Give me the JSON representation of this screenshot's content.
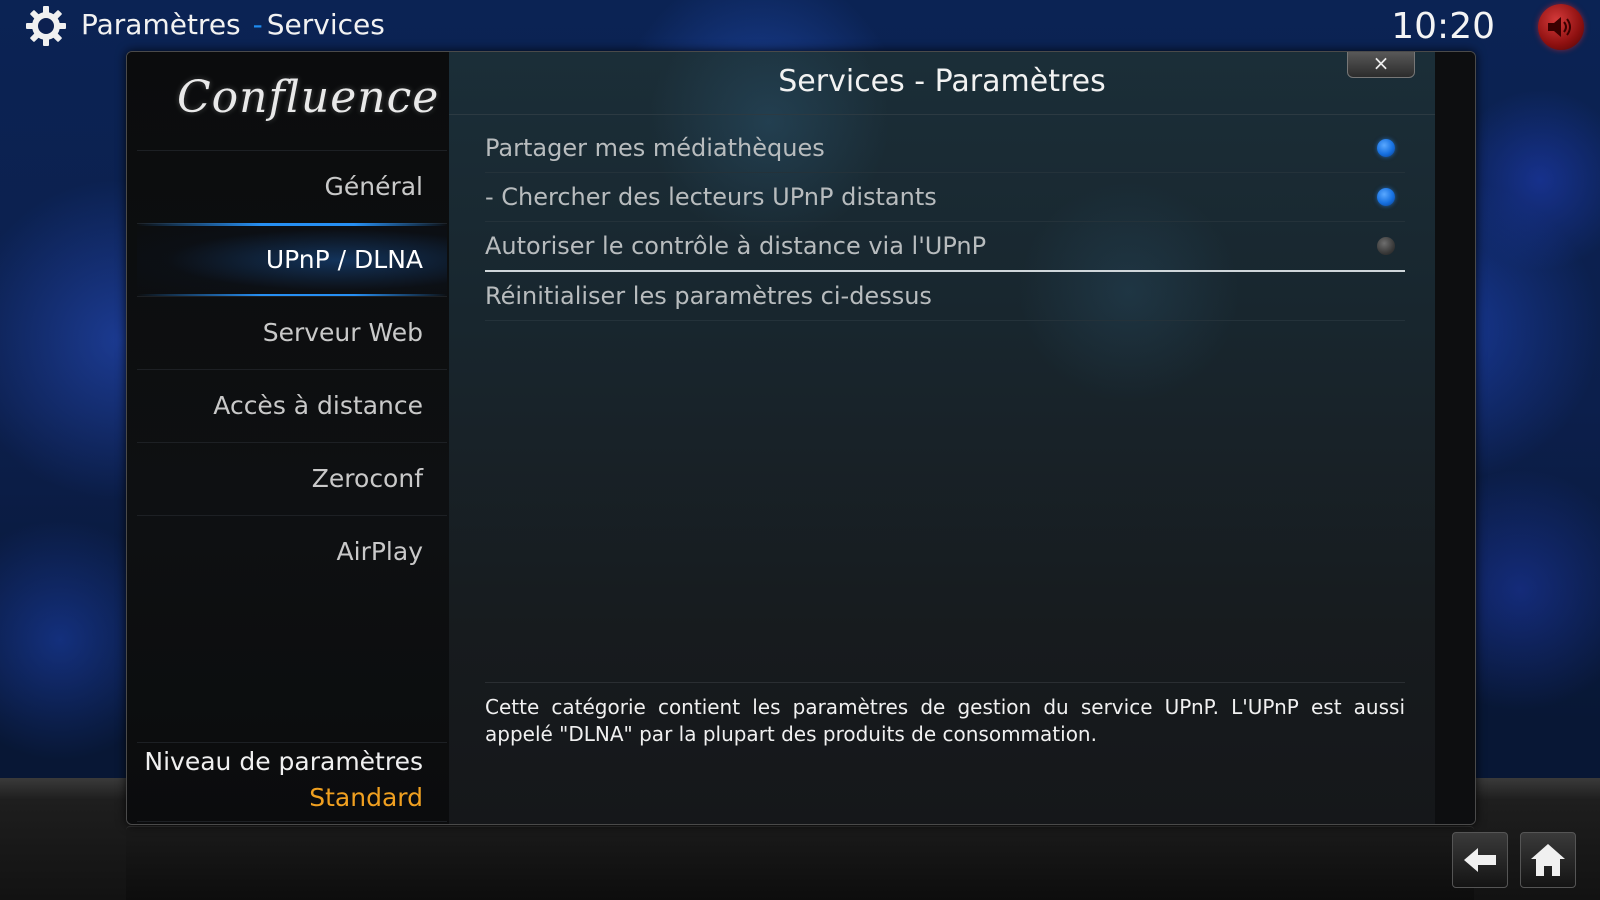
{
  "header": {
    "section": "Paramètres",
    "separator": "-",
    "page": "Services",
    "clock": "10:20",
    "settings_icon": "gear-icon",
    "mute_icon": "volume-muted-icon"
  },
  "sidebar": {
    "logo": "Confluence",
    "items": [
      {
        "label": "Général"
      },
      {
        "label": "UPnP / DLNA",
        "active": true
      },
      {
        "label": "Serveur Web"
      },
      {
        "label": "Accès à distance"
      },
      {
        "label": "Zeroconf"
      },
      {
        "label": "AirPlay"
      }
    ],
    "level_label": "Niveau de paramètres",
    "level_value": "Standard"
  },
  "dialog": {
    "title": "Services - Paramètres",
    "close_label": "×",
    "settings": [
      {
        "label": "Partager mes médiathèques",
        "toggle": "on"
      },
      {
        "label": "- Chercher des lecteurs UPnP distants",
        "toggle": "on"
      },
      {
        "label": "Autoriser le contrôle à distance via l'UPnP",
        "toggle": "off"
      },
      {
        "label": "Réinitialiser les paramètres ci-dessus"
      }
    ],
    "description": "Cette catégorie contient les paramètres de gestion du service UPnP. L'UPnP est aussi appelé \"DLNA\" par la plupart des produits de consommation."
  },
  "footer": {
    "back_icon": "back-arrow-icon",
    "home_icon": "home-icon"
  },
  "colors": {
    "accent": "#1e8bf0",
    "level_value": "#f0a020",
    "toggle_on": "#1670e0",
    "mute": "#b01818"
  }
}
